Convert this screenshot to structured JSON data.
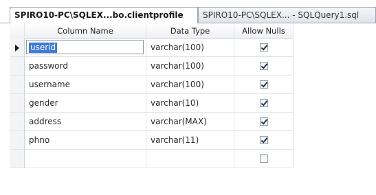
{
  "tabs": [
    {
      "label": "SPIRO10-PC\\SQLEX...bo.clientprofile",
      "active": true
    },
    {
      "label": "SPIRO10-PC\\SQLEX... - SQLQuery1.sql",
      "active": false
    }
  ],
  "grid": {
    "headers": {
      "column_name": "Column Name",
      "data_type": "Data Type",
      "allow_nulls": "Allow Nulls"
    },
    "rows": [
      {
        "name": "userid",
        "type": "varchar(100)",
        "allow_nulls": true,
        "current": true
      },
      {
        "name": "password",
        "type": "varchar(100)",
        "allow_nulls": true
      },
      {
        "name": "username",
        "type": "varchar(100)",
        "allow_nulls": true
      },
      {
        "name": "gender",
        "type": "varchar(10)",
        "allow_nulls": true
      },
      {
        "name": "address",
        "type": "varchar(MAX)",
        "allow_nulls": true
      },
      {
        "name": "phno",
        "type": "varchar(11)",
        "allow_nulls": true
      },
      {
        "name": "",
        "type": "",
        "allow_nulls": false
      }
    ]
  },
  "icons": {
    "row_selector": "current-row-arrow-icon",
    "checkbox": "checkbox-icon"
  },
  "colors": {
    "selection": "#3d7bd9",
    "grid_line": "#dfe3e8"
  }
}
